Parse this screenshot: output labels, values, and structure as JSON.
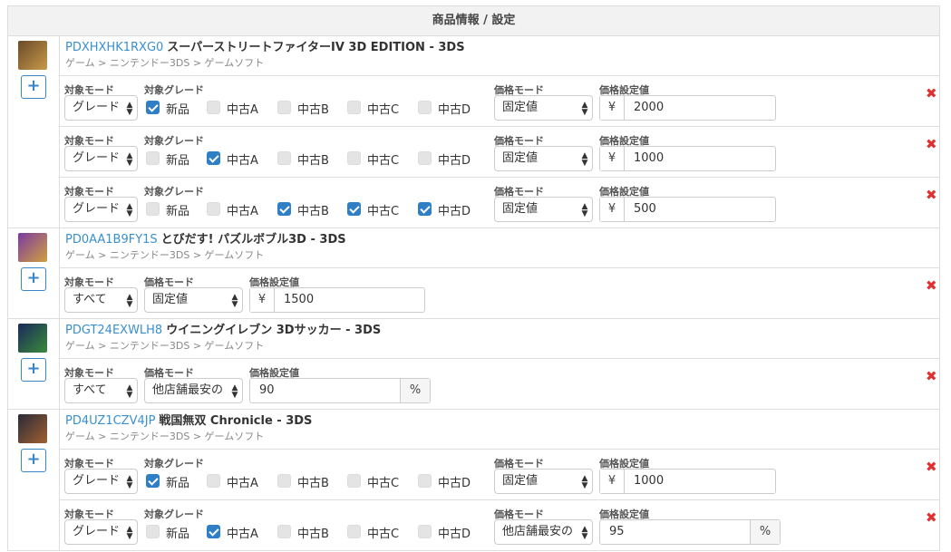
{
  "table": {
    "header": "商品情報 / 設定"
  },
  "labels": {
    "target_mode": "対象モード",
    "target_grade": "対象グレード",
    "price_mode": "価格モード",
    "price_value": "価格設定値",
    "yen": "¥",
    "percent": "%",
    "add": "+",
    "delete": "✖"
  },
  "grades": [
    "新品",
    "中古A",
    "中古B",
    "中古C",
    "中古D"
  ],
  "products": [
    {
      "code": "PDXHXHK1RXG0",
      "title": "スーパーストリートファイターIV 3D EDITION - 3DS",
      "category": "ゲーム > ニンテンドー3DS > ゲームソフト",
      "thumb_colors": [
        "#6a4a2a",
        "#c89a4a"
      ],
      "rules": [
        {
          "target_mode": "グレード",
          "grades": [
            true,
            false,
            false,
            false,
            false
          ],
          "price_mode": "固定値",
          "value": "2000",
          "unit": "yen"
        },
        {
          "target_mode": "グレード",
          "grades": [
            false,
            true,
            false,
            false,
            false
          ],
          "price_mode": "固定値",
          "value": "1000",
          "unit": "yen"
        },
        {
          "target_mode": "グレード",
          "grades": [
            false,
            false,
            true,
            true,
            true
          ],
          "price_mode": "固定値",
          "value": "500",
          "unit": "yen"
        }
      ]
    },
    {
      "code": "PD0AA1B9FY1S",
      "title": "とびだす! パズルボブル3D - 3DS",
      "category": "ゲーム > ニンテンドー3DS > ゲームソフト",
      "thumb_colors": [
        "#7a3aa0",
        "#d0a040"
      ],
      "rules": [
        {
          "target_mode": "すべて",
          "price_mode": "固定値",
          "value": "1500",
          "unit": "yen"
        }
      ]
    },
    {
      "code": "PDGT24EXWLH8",
      "title": "ウイニングイレブン 3Dサッカー - 3DS",
      "category": "ゲーム > ニンテンドー3DS > ゲームソフト",
      "thumb_colors": [
        "#1a2a5a",
        "#3a8a3a"
      ],
      "rules": [
        {
          "target_mode": "すべて",
          "price_mode": "他店舗最安の",
          "value": "90",
          "unit": "percent"
        }
      ]
    },
    {
      "code": "PD4UZ1CZV4JP",
      "title": "戦国無双 Chronicle - 3DS",
      "category": "ゲーム > ニンテンドー3DS > ゲームソフト",
      "thumb_colors": [
        "#2a2a3a",
        "#a06030"
      ],
      "rules": [
        {
          "target_mode": "グレード",
          "grades": [
            true,
            false,
            false,
            false,
            false
          ],
          "price_mode": "固定値",
          "value": "1000",
          "unit": "yen"
        },
        {
          "target_mode": "グレード",
          "grades": [
            false,
            true,
            false,
            false,
            false
          ],
          "price_mode": "他店舗最安の",
          "value": "95",
          "unit": "percent"
        }
      ]
    }
  ]
}
